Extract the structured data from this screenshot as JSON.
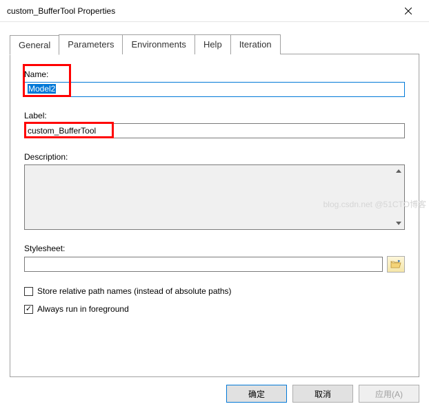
{
  "window": {
    "title": "custom_BufferTool Properties"
  },
  "tabs": {
    "general": "General",
    "parameters": "Parameters",
    "environments": "Environments",
    "help": "Help",
    "iteration": "Iteration"
  },
  "fields": {
    "name_label": "Name:",
    "name_value": "Model2",
    "label_label": "Label:",
    "label_value": "custom_BufferTool",
    "description_label": "Description:",
    "stylesheet_label": "Stylesheet:"
  },
  "checkboxes": {
    "relative_paths": "Store relative path names (instead of absolute paths)",
    "foreground": "Always run in foreground"
  },
  "buttons": {
    "ok": "确定",
    "cancel": "取消",
    "apply": "应用(A)"
  },
  "watermark": "blog.csdn.net  @51CTO博客"
}
